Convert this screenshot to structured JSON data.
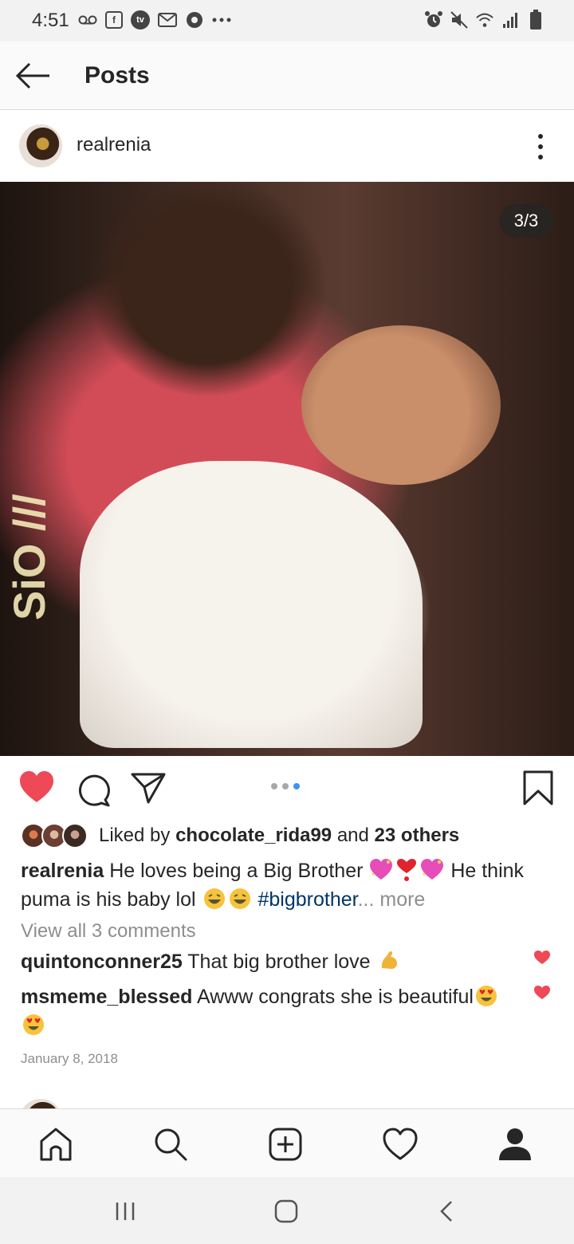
{
  "status_bar": {
    "time": "4:51",
    "left_icons": [
      "voicemail-icon",
      "facebook-icon",
      "tv-icon",
      "gmail-icon",
      "chrome-icon",
      "more-dots-icon"
    ],
    "right_icons": [
      "alarm-icon",
      "mute-icon",
      "wifi-icon",
      "signal-icon",
      "battery-icon"
    ]
  },
  "header": {
    "title": "Posts"
  },
  "post": {
    "username": "realrenia",
    "image_counter": "3/3",
    "carousel": {
      "total": 3,
      "active_index": 3
    },
    "liked": true,
    "likes": {
      "prefix": "Liked by ",
      "first_user": "chocolate_rida99",
      "middle": " and ",
      "others": "23 others"
    },
    "caption": {
      "username": "realrenia",
      "text_part1": " He loves being a Big Brother ",
      "emojis_part1": [
        "sparkling-heart-emoji",
        "heart-exclamation-emoji",
        "sparkling-heart-emoji"
      ],
      "text_part2": " He think puma is his baby lol ",
      "emojis_part2": [
        "laughing-emoji",
        "laughing-emoji"
      ],
      "hashtag": "#bigbrother",
      "ellipsis": "...",
      "more": " more"
    },
    "view_comments": "View all 3 comments",
    "comments": [
      {
        "username": "quintonconner25",
        "text": " That big brother love ",
        "emoji": "flexed-biceps-emoji"
      },
      {
        "username": "msmeme_blessed",
        "text": " Awww congrats she is beautiful",
        "emoji": "heart-eyes-emoji",
        "emoji_line2": "heart-eyes-emoji"
      }
    ],
    "date": "January 8, 2018"
  },
  "colors": {
    "like_red": "#ed4956",
    "hashtag_blue": "#003569",
    "carousel_active": "#3897f0",
    "secondary_text": "#8e8e8e"
  },
  "photo_decor": {
    "shirt_text": "SiO ///"
  },
  "bottom_nav": [
    "home-icon",
    "search-icon",
    "add-post-icon",
    "activity-heart-icon",
    "profile-icon"
  ],
  "system_nav": [
    "recent-apps-icon",
    "home-button-icon",
    "back-icon"
  ]
}
